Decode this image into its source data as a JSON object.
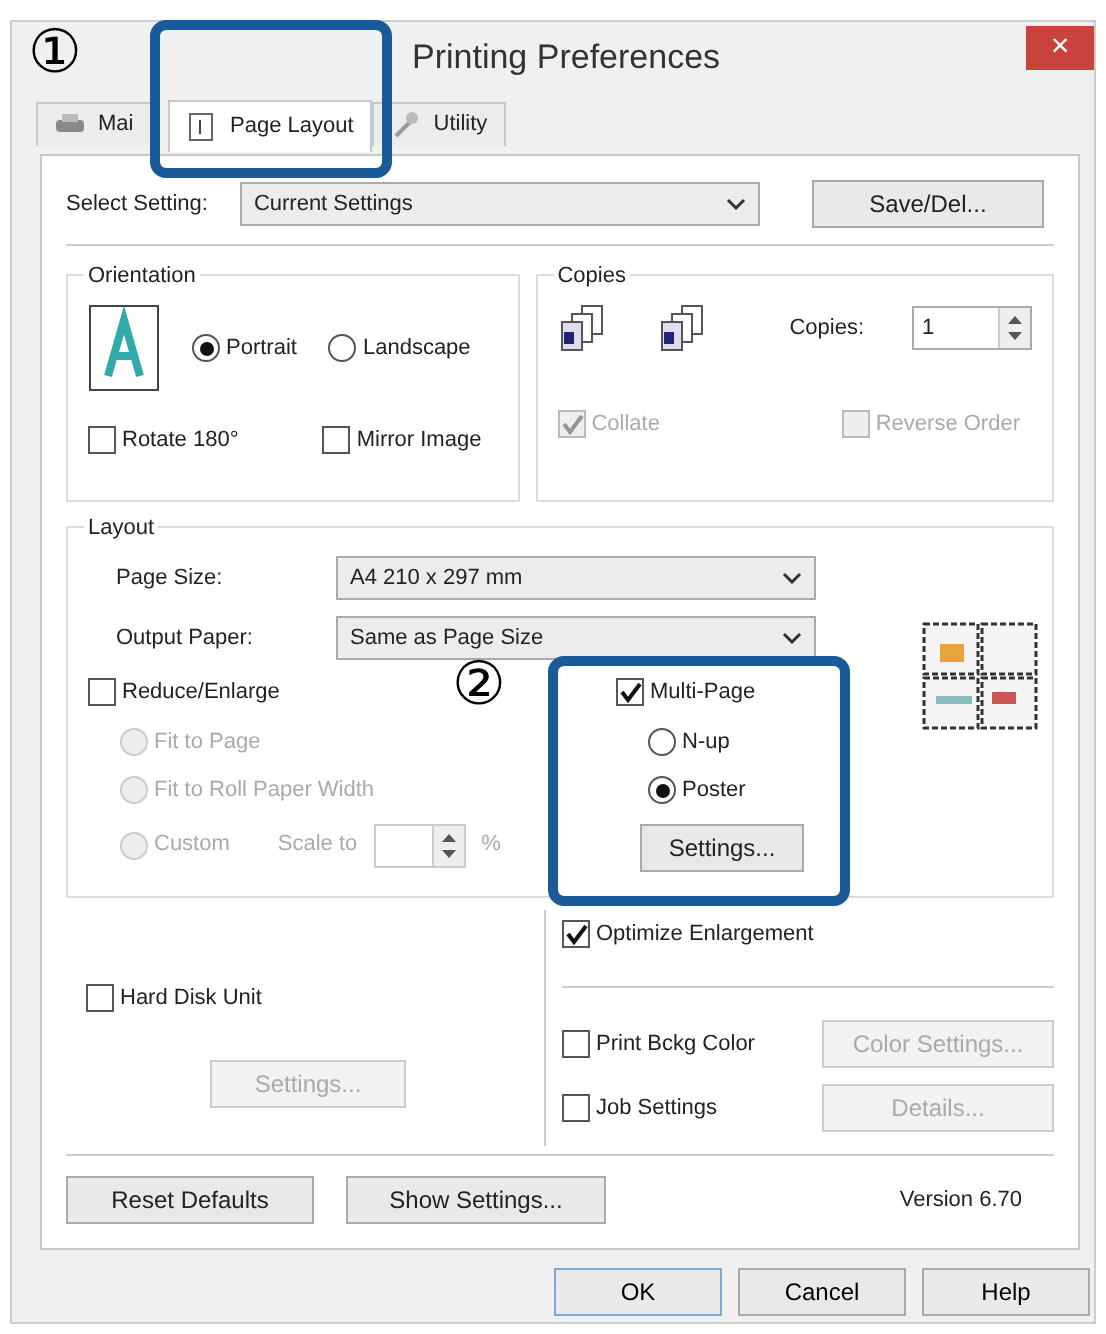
{
  "window": {
    "title": "Printing Preferences",
    "close": "×"
  },
  "callouts": [
    {
      "label": "①"
    },
    {
      "label": "②"
    }
  ],
  "tabs": [
    {
      "label": "Mai",
      "kind": "printer",
      "selected": false
    },
    {
      "label": "Page Layout",
      "kind": "page",
      "selected": true
    },
    {
      "label": "Utility",
      "kind": "wrench",
      "selected": false
    }
  ],
  "select_setting": {
    "label": "Select Setting:",
    "value": "Current Settings",
    "button": "Save/Del..."
  },
  "orientation": {
    "title": "Orientation",
    "options": [
      {
        "label": "Portrait",
        "selected": true
      },
      {
        "label": "Landscape",
        "selected": false
      }
    ],
    "checkboxes": [
      {
        "label": "Rotate 180°",
        "checked": false
      },
      {
        "label": "Mirror Image",
        "checked": false
      }
    ]
  },
  "copies": {
    "title": "Copies",
    "label": "Copies:",
    "value": "1",
    "checkboxes": [
      {
        "label": "Collate",
        "checked": true,
        "disabled": true
      },
      {
        "label": "Reverse Order",
        "checked": false,
        "disabled": true
      }
    ]
  },
  "layout": {
    "title": "Layout",
    "page_size": {
      "label": "Page Size:",
      "value": "A4 210 x 297 mm"
    },
    "output_paper": {
      "label": "Output Paper:",
      "value": "Same as Page Size"
    },
    "reduce_enlarge": {
      "label": "Reduce/Enlarge",
      "checked": false
    },
    "fit_options": [
      {
        "label": "Fit to Page",
        "selected": false,
        "disabled": true
      },
      {
        "label": "Fit to Roll Paper Width",
        "selected": false,
        "disabled": true
      },
      {
        "label": "Custom",
        "selected": false,
        "disabled": true
      }
    ],
    "scale": {
      "label": "Scale to",
      "unit": "%",
      "disabled": true
    },
    "multi_page": {
      "label": "Multi-Page",
      "checked": true
    },
    "multi_options": [
      {
        "label": "N-up",
        "selected": false
      },
      {
        "label": "Poster",
        "selected": true
      }
    ],
    "settings_button": "Settings..."
  },
  "extras": {
    "optimize": {
      "label": "Optimize Enlargement",
      "checked": true
    },
    "hard_disk": {
      "label": "Hard Disk Unit",
      "checked": false
    },
    "hd_settings": {
      "label": "Settings...",
      "disabled": true
    },
    "print_bckg": {
      "label": "Print Bckg Color",
      "checked": false
    },
    "color_settings": {
      "label": "Color Settings...",
      "disabled": true
    },
    "job_settings": {
      "label": "Job Settings",
      "checked": false
    },
    "details": {
      "label": "Details...",
      "disabled": true
    }
  },
  "footer": {
    "buttons": [
      "Reset Defaults",
      "Show Settings..."
    ],
    "version": "Version 6.70"
  },
  "dialog_buttons": [
    "OK",
    "Cancel",
    "Help"
  ]
}
